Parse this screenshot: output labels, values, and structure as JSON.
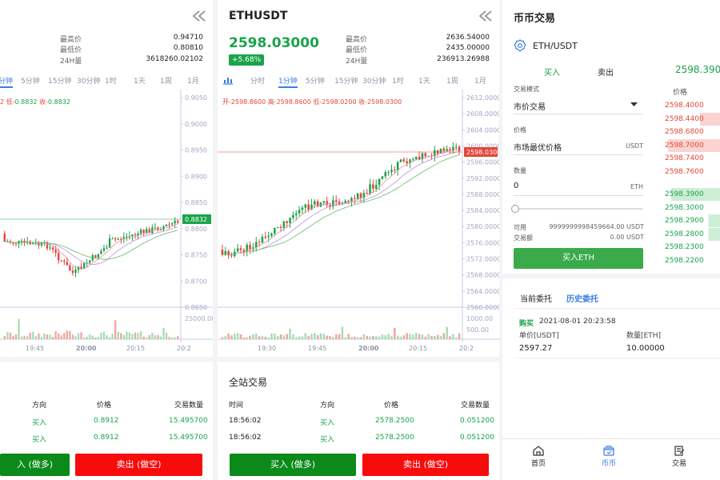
{
  "left_panel": {
    "stats": [
      {
        "label": "最高价",
        "value": "0.94710"
      },
      {
        "label": "最低价",
        "value": "0.80810"
      },
      {
        "label": "24H量",
        "value": "3618260.02102"
      }
    ],
    "timeframes": [
      "分钟",
      "5分钟",
      "15分钟",
      "30分钟",
      "1时",
      "1天",
      "1周",
      "1月"
    ],
    "ohlc": {
      "p1": "2",
      "low_label": "低-",
      "low": "0.8832",
      "close_label": "收-",
      "close": "0.8832"
    },
    "y_ticks": [
      "0.9050",
      "0.9000",
      "0.8950",
      "0.8900",
      "0.8850",
      "0.8800",
      "0.8750",
      "0.8700",
      "0.8650"
    ],
    "current_price_tag": "0.8832",
    "vol_tick": "25000.00",
    "x_ticks": [
      "19:45",
      "20:00",
      "20:15",
      "20:2"
    ],
    "trades_header": {
      "direction": "方向",
      "price": "价格",
      "qty": "交易数量"
    },
    "trades": [
      {
        "direction": "买入",
        "price": "0.8912",
        "qty": "15.495700"
      },
      {
        "direction": "买入",
        "price": "0.8912",
        "qty": "15.495700"
      }
    ],
    "buy_label": "入 (做多)",
    "sell_label": "卖出 (做空)"
  },
  "mid_panel": {
    "symbol": "ETHUSDT",
    "price": "2598.03000",
    "change": "+5.68%",
    "stats": [
      {
        "label": "最高价",
        "value": "2636.54000"
      },
      {
        "label": "最低价",
        "value": "2435.00000"
      },
      {
        "label": "24H量",
        "value": "236913.26988"
      }
    ],
    "timeframes": [
      "分时",
      "1分钟",
      "5分钟",
      "15分钟",
      "30分钟",
      "1时",
      "1天",
      "1周",
      "1月"
    ],
    "active_timeframe": "1分钟",
    "ohlc": {
      "o_label": "开-",
      "o": "2598.8600",
      "h_label": "高-",
      "h": "2598.8600",
      "l_label": "低-",
      "l": "2598.0200",
      "c_label": "收-",
      "c": "2598.0300"
    },
    "y_ticks": [
      "2612.0000",
      "2608.0000",
      "2604.0000",
      "2600.0000",
      "2596.0000",
      "2592.0000",
      "2588.0000",
      "2584.0000",
      "2580.0000",
      "2576.0000",
      "2572.0000",
      "2568.0000",
      "2564.0000",
      "2560.0000"
    ],
    "current_price_tag": "2598.0300",
    "vol_ticks": [
      "1000.00",
      "500.00"
    ],
    "x_ticks": [
      "19:30",
      "19:45",
      "20:00",
      "20:15",
      "20:2"
    ],
    "trades_title": "全站交易",
    "trades_header": {
      "time": "时间",
      "direction": "方向",
      "price": "价格",
      "qty": "交易数量"
    },
    "trades": [
      {
        "time": "18:56:02",
        "direction": "买入",
        "price": "2578.2500",
        "qty": "0.051200"
      },
      {
        "time": "18:56:02",
        "direction": "买入",
        "price": "2578.2500",
        "qty": "0.051200"
      }
    ],
    "buy_label": "买入 (做多)",
    "sell_label": "卖出 (做空)"
  },
  "right_panel": {
    "title": "币币交易",
    "pair": "ETH/USDT",
    "tabs": {
      "buy": "买入",
      "sell": "卖出"
    },
    "last_price": "2598.3900",
    "order_type_label": "交易模式",
    "order_type_value": "市价交易",
    "price_label": "价格",
    "price_value": "市场最优价格",
    "price_unit": "USDT",
    "qty_label": "数量",
    "qty_value": "0",
    "qty_unit": "ETH",
    "available_label": "可用",
    "available_value": "9999999998459664.00 USDT",
    "amount_label": "交易额",
    "amount_value": "0.00 USDT",
    "buy_button": "买入ETH",
    "orderbook_header": "价格",
    "asks": [
      "2598.4000",
      "2598.4400",
      "2598.6800",
      "2598.7000",
      "2598.7400",
      "2598.7600"
    ],
    "bids": [
      "2598.3900",
      "2598.3000",
      "2598.2900",
      "2598.2800",
      "2598.2300",
      "2598.2200"
    ],
    "order_tabs": {
      "current": "当前委托",
      "history": "历史委托"
    },
    "history_order": {
      "side": "购买",
      "time": "2021-08-01 20:23:58",
      "price_label": "单价[USDT]",
      "qty_label": "数量[ETH]",
      "price": "2597.27",
      "qty": "10.00000"
    },
    "nav": [
      {
        "label": "首页"
      },
      {
        "label": "币币"
      },
      {
        "label": "交易"
      }
    ],
    "colors": {
      "up": "#1aa34a",
      "down": "#e6453a",
      "accent": "#3b7de0"
    }
  }
}
